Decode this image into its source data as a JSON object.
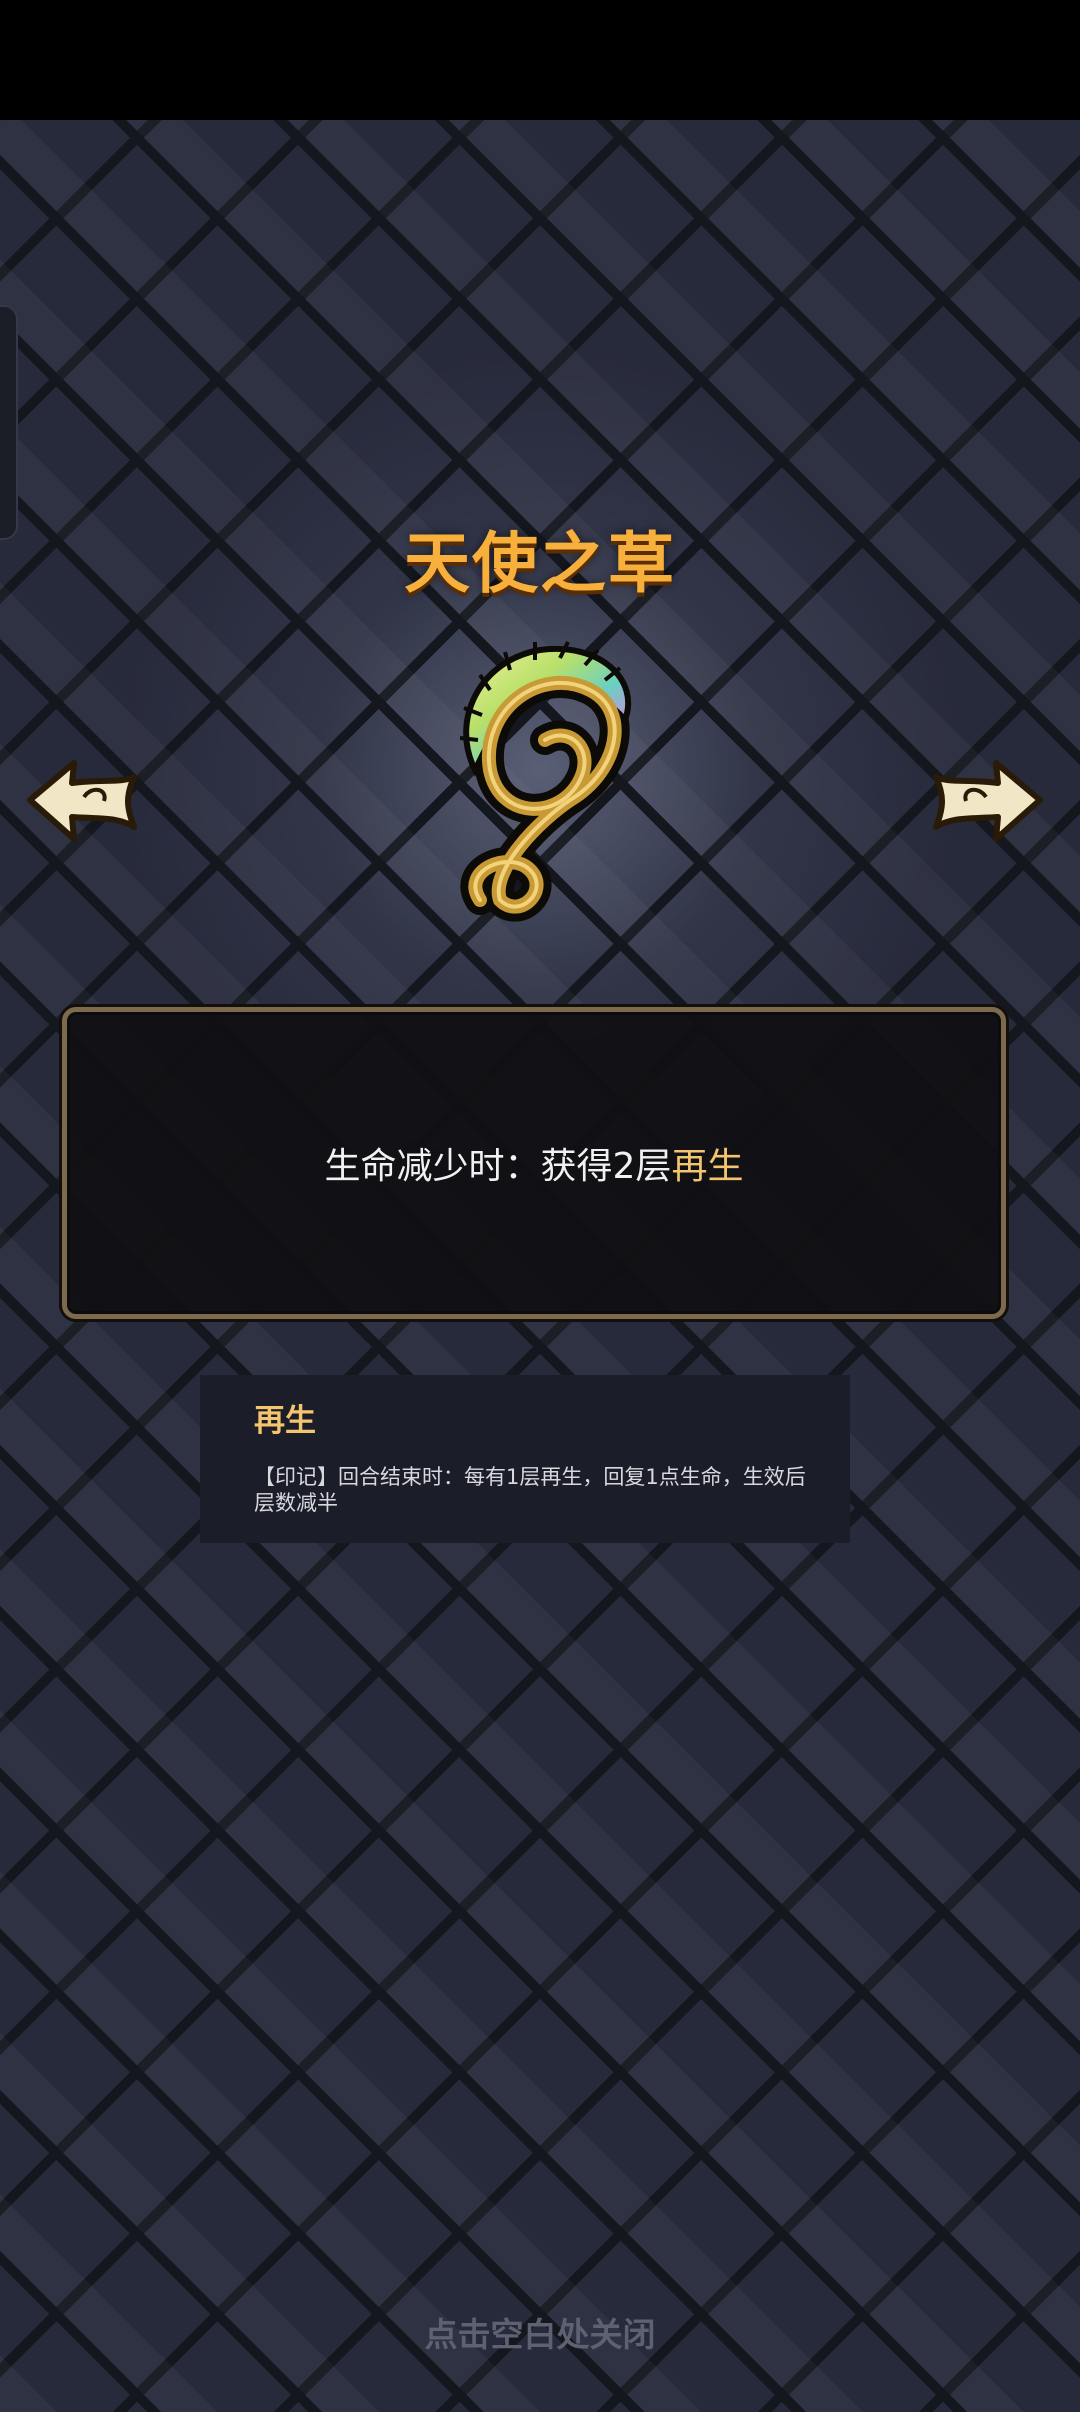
{
  "relic": {
    "name": "天使之草",
    "description_prefix": "生命减少时：获得2层",
    "description_keyword": "再生"
  },
  "tooltip": {
    "keyword": "再生",
    "text": "【印记】回合结束时：每有1层再生，回复1点生命，生效后层数减半"
  },
  "footer": {
    "close_hint": "点击空白处关闭"
  },
  "icons": {
    "previous": "arrow-left-icon",
    "next": "arrow-right-icon",
    "relic": "angel-grass-icon"
  },
  "colors": {
    "title": "#f6b03b",
    "keyword": "#f3c56f",
    "panel_border": "#7d6a4d",
    "background": "#272a3b"
  }
}
